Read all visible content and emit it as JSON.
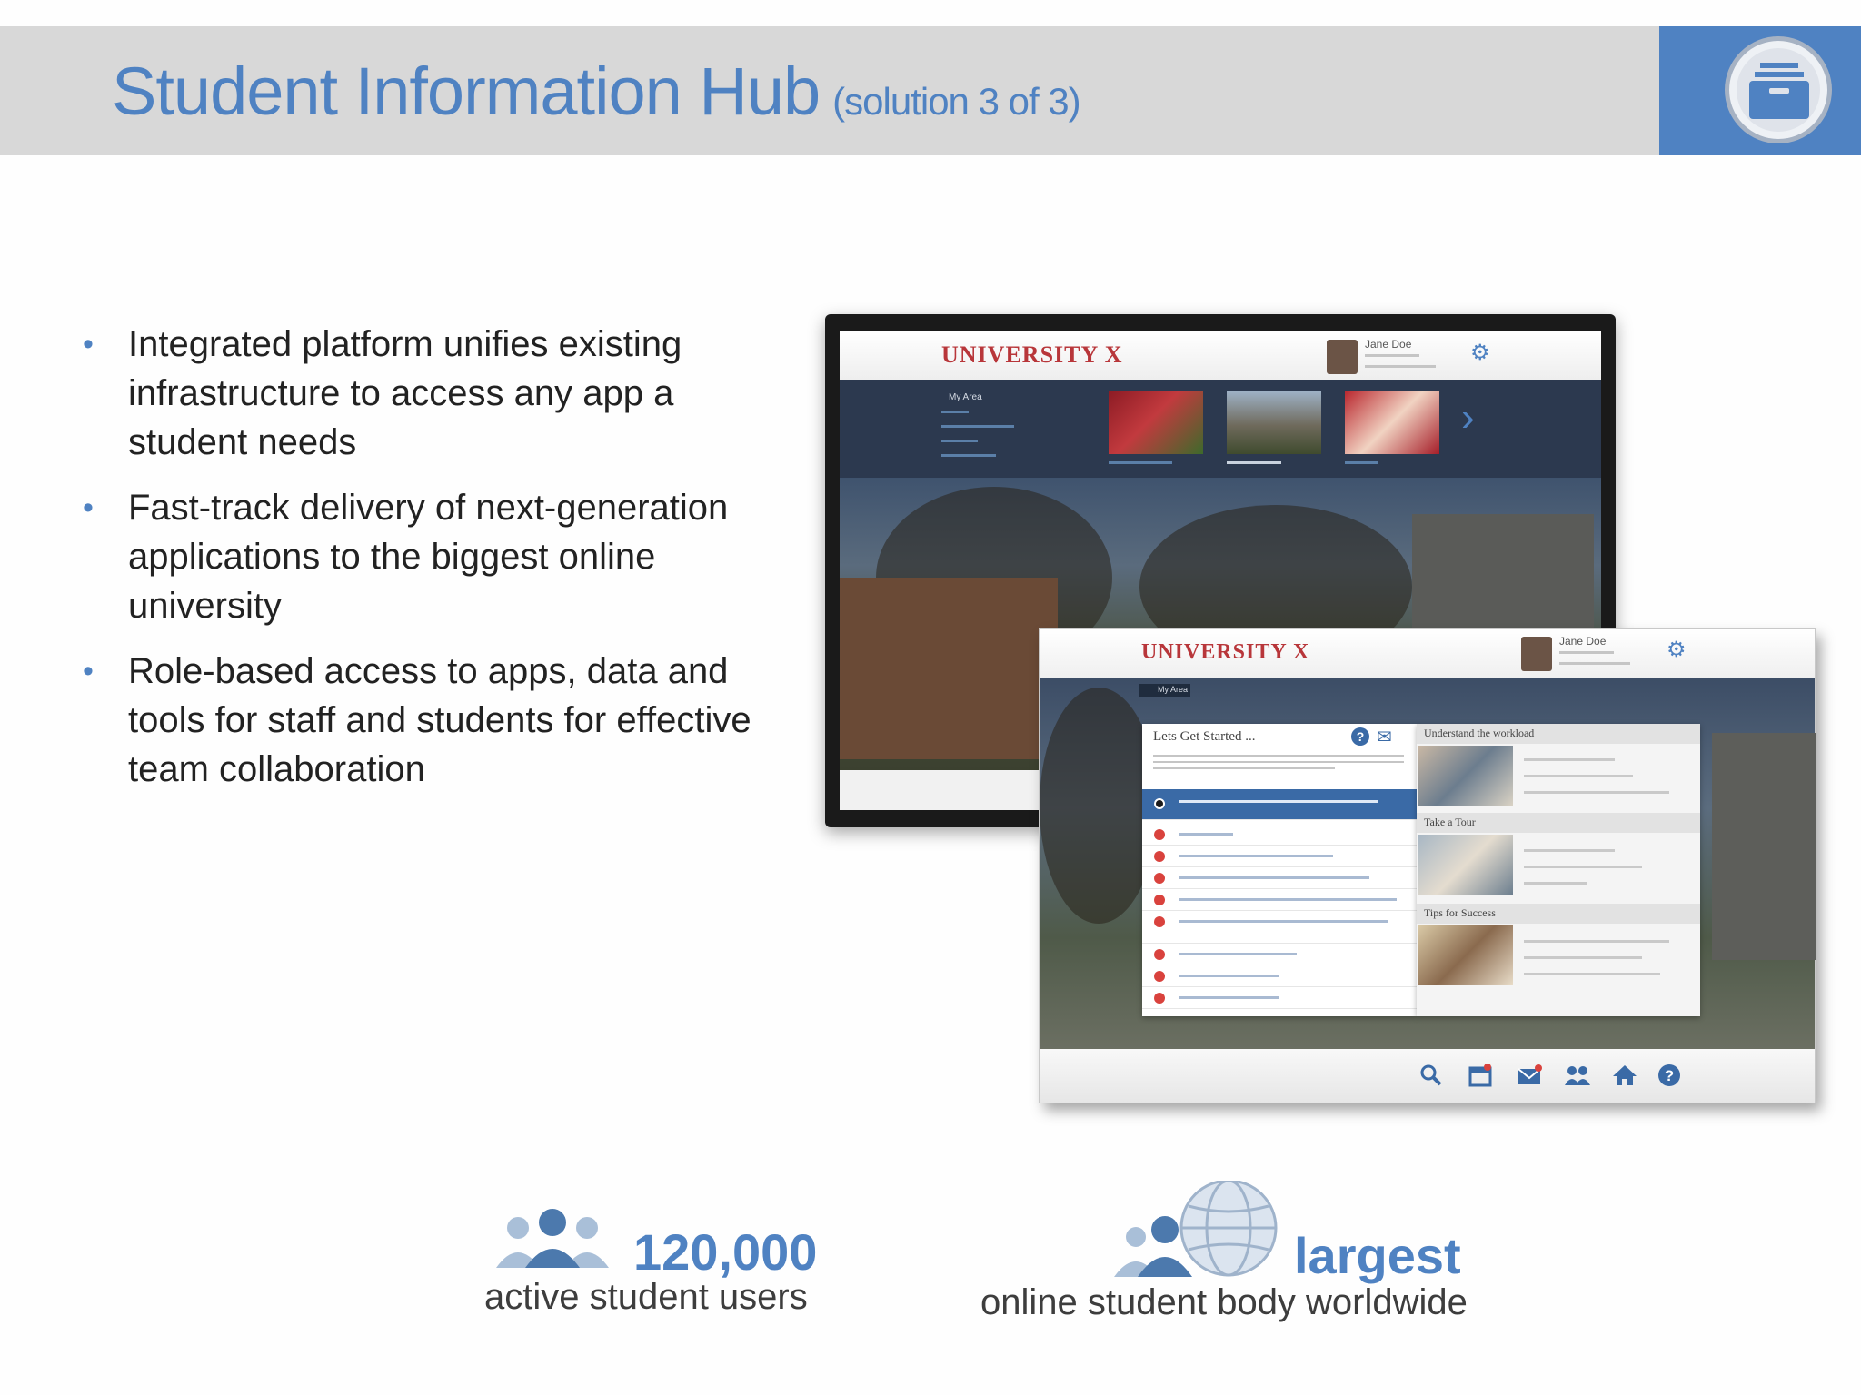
{
  "header": {
    "title": "Student Information Hub",
    "subtitle": "(solution 3 of 3)",
    "brand_icon": "archive-box-icon",
    "colors": {
      "band": "#d8d8d8",
      "accent": "#4f82c2"
    }
  },
  "bullets": [
    "Integrated platform unifies existing infrastructure to access any app a student needs",
    "Fast-track delivery of next-generation applications to the biggest online university",
    "Role-based access to apps, data and tools for staff and students for effective team collaboration"
  ],
  "screenshot_back": {
    "brand": "UNIVERSITY X",
    "user_name": "Jane Doe",
    "nav_first": "My Area"
  },
  "screenshot_front": {
    "brand": "UNIVERSITY X",
    "user_name": "Jane Doe",
    "breadcrumb": "My Area",
    "left_panel_title": "Lets Get Started ...",
    "right_sections": [
      "Understand the workload",
      "Take a Tour",
      "Tips for Success"
    ],
    "footer_icons": [
      "search-icon",
      "calendar-icon",
      "mail-icon",
      "users-icon",
      "home-icon",
      "help-icon"
    ]
  },
  "stats": [
    {
      "value": "120,000",
      "label": "active student users",
      "icon": "people-icon"
    },
    {
      "value": "largest",
      "label": "online student body worldwide",
      "icon": "globe-people-icon"
    }
  ]
}
